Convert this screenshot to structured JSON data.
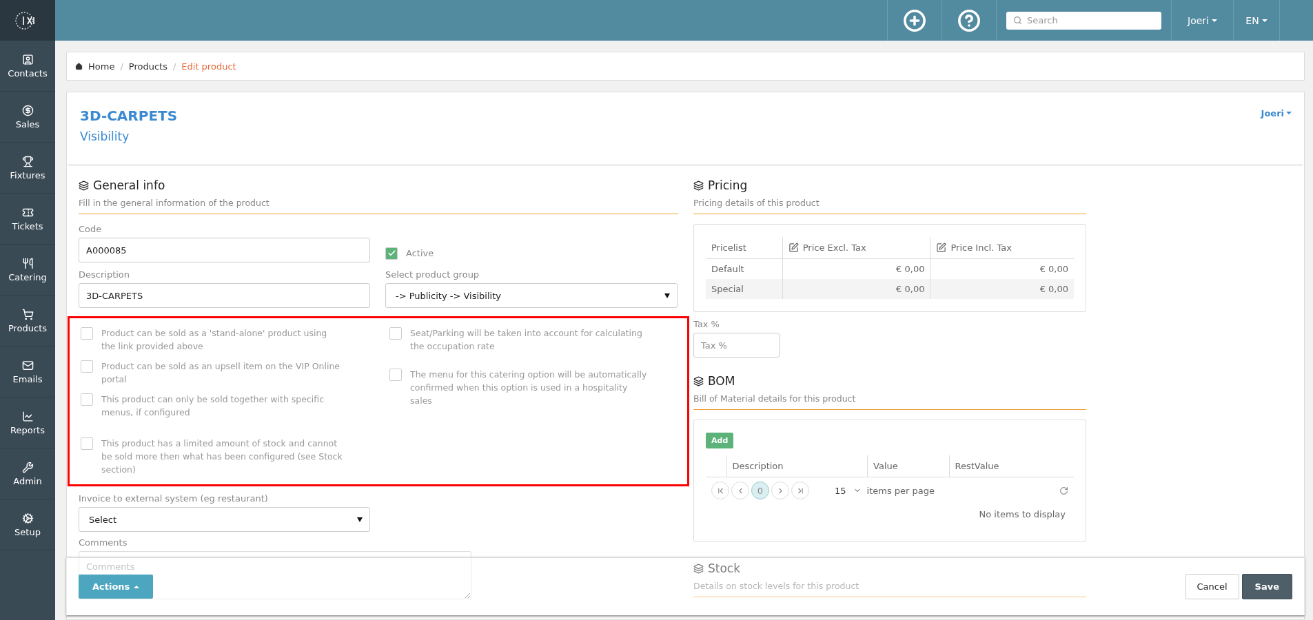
{
  "topbar": {
    "search": {
      "placeholder": "Search"
    },
    "user": "Joeri",
    "language": "EN"
  },
  "sidebar": {
    "items": [
      {
        "label": "Contacts"
      },
      {
        "label": "Sales"
      },
      {
        "label": "Fixtures"
      },
      {
        "label": "Tickets"
      },
      {
        "label": "Catering"
      },
      {
        "label": "Products"
      },
      {
        "label": "Emails"
      },
      {
        "label": "Reports"
      },
      {
        "label": "Admin"
      },
      {
        "label": "Setup"
      }
    ]
  },
  "breadcrumb_separator": "/",
  "breadcrumb": [
    {
      "label": "Home",
      "current": false
    },
    {
      "label": "Products",
      "current": false
    },
    {
      "label": "Edit product",
      "current": true
    }
  ],
  "page": {
    "title": "3D-CARPETS",
    "subtitle": "Visibility",
    "user_menu": "Joeri"
  },
  "general_info": {
    "title": "General info",
    "description": "Fill in the general information of the product",
    "code": {
      "label": "Code",
      "value": "A000085"
    },
    "active": {
      "label": "Active",
      "checked": true
    },
    "description_field": {
      "label": "Description",
      "value": "3D-CARPETS"
    },
    "product_group": {
      "label": "Select product group",
      "value": "-> Publicity -> Visibility"
    },
    "options_left": [
      {
        "label": "Product can be sold as a 'stand-alone' product using the link provided above",
        "checked": false
      },
      {
        "label": "Product can be sold as an upsell item on the VIP Online portal",
        "checked": false
      },
      {
        "label": "This product can only be sold together with specific menus, if configured",
        "checked": false
      },
      {
        "label": "This product has a limited amount of stock and cannot be sold more then what has been configured (see Stock section)",
        "checked": false
      }
    ],
    "options_right": [
      {
        "label": "Seat/Parking will be taken into account for calculating the occupation rate",
        "checked": false
      },
      {
        "label": "The menu for this catering option will be automatically confirmed when this option is used in a hospitality sales",
        "checked": false
      }
    ],
    "invoice": {
      "label": "Invoice to external system (eg restaurant)",
      "value": "Select"
    },
    "comments": {
      "label": "Comments",
      "placeholder": "Comments"
    }
  },
  "pricing": {
    "title": "Pricing",
    "description": "Pricing details of this product",
    "columns": [
      "Pricelist",
      "Price Excl. Tax",
      "Price Incl. Tax"
    ],
    "rows": [
      {
        "name": "Default",
        "excl": "€ 0,00",
        "incl": "€ 0,00"
      },
      {
        "name": "Special",
        "excl": "€ 0,00",
        "incl": "€ 0,00"
      }
    ],
    "tax": {
      "label": "Tax %",
      "placeholder": "Tax %"
    }
  },
  "bom": {
    "title": "BOM",
    "description": "Bill of Material details for this product",
    "add_button": "Add",
    "columns": [
      "Description",
      "Value",
      "RestValue"
    ],
    "pages": [
      {
        "label": "0",
        "selected": true
      }
    ],
    "page_size": "15",
    "page_size_label": "items per page",
    "empty": "No items to display"
  },
  "stock": {
    "title": "Stock",
    "description": "Details on stock levels for this product"
  },
  "actions": {
    "menu": "Actions",
    "cancel": "Cancel",
    "save": "Save"
  }
}
